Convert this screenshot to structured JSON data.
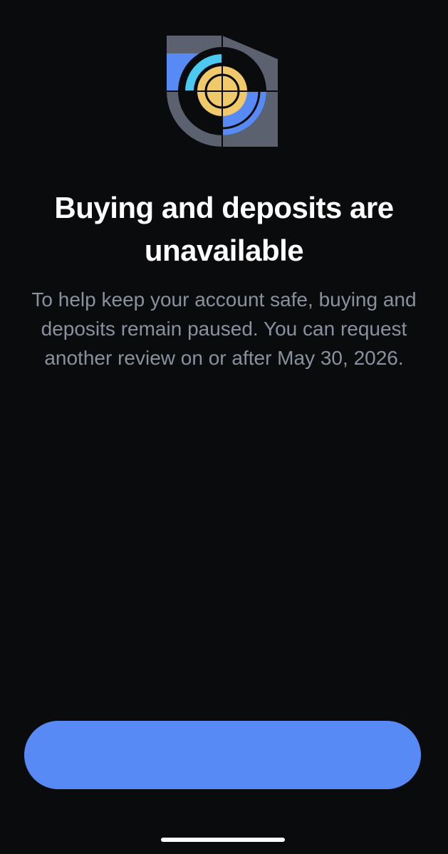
{
  "screen": {
    "title": "Buying and deposits are unavailable",
    "message": "To help keep your account safe, buying and deposits remain paused. You can request another review on or after May 30, 2026.",
    "primary_button_label": ""
  },
  "icons": {
    "illustration": "shield-lock-illustration-icon"
  },
  "colors": {
    "background": "#0a0b0d",
    "title": "#ffffff",
    "message": "#8a919e",
    "accent_blue": "#588af5",
    "accent_cyan": "#4cc9f0",
    "accent_yellow": "#f0ca6a",
    "shield_gray": "#5b616e"
  }
}
